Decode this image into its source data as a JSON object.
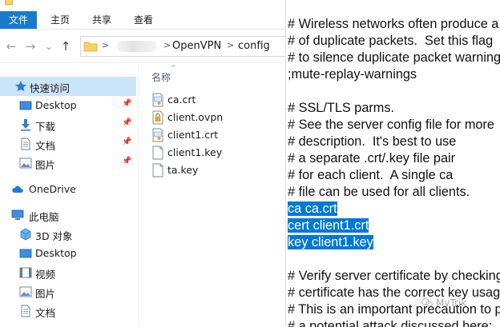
{
  "ribbon": {
    "tabs": [
      {
        "label": "文件",
        "active": true
      },
      {
        "label": "主页",
        "active": false
      },
      {
        "label": "共享",
        "active": false
      },
      {
        "label": "查看",
        "active": false
      }
    ]
  },
  "address_bar": {
    "nav_buttons": {
      "back": "←",
      "forward": "→",
      "recent": "⌄",
      "up": "↑"
    },
    "crumbs": [
      "OpenVPN",
      "config"
    ]
  },
  "nav_pane": {
    "items": [
      {
        "label": "快速访问",
        "icon": "star-icon",
        "selected": true,
        "pinned": false
      },
      {
        "label": "Desktop",
        "icon": "desktop-icon",
        "selected": false,
        "pinned": true
      },
      {
        "label": "下载",
        "icon": "download-icon",
        "selected": false,
        "pinned": true
      },
      {
        "label": "文档",
        "icon": "document-icon",
        "selected": false,
        "pinned": true
      },
      {
        "label": "图片",
        "icon": "picture-icon",
        "selected": false,
        "pinned": true
      },
      {
        "label": "OneDrive",
        "icon": "cloud-icon",
        "selected": false,
        "pinned": false
      },
      {
        "label": "此电脑",
        "icon": "computer-icon",
        "selected": false,
        "pinned": false
      },
      {
        "label": "3D 对象",
        "icon": "cube-icon",
        "selected": false,
        "pinned": false
      },
      {
        "label": "Desktop",
        "icon": "desktop-icon",
        "selected": false,
        "pinned": false
      },
      {
        "label": "视频",
        "icon": "video-icon",
        "selected": false,
        "pinned": false
      },
      {
        "label": "图片",
        "icon": "picture-icon",
        "selected": false,
        "pinned": false
      },
      {
        "label": "文档",
        "icon": "document-icon",
        "selected": false,
        "pinned": false
      }
    ]
  },
  "file_list": {
    "column_header": "名称",
    "sort_indicator": "^",
    "files": [
      {
        "name": "ca.crt",
        "icon": "certificate-icon"
      },
      {
        "name": "client.ovpn",
        "icon": "lock-file-icon"
      },
      {
        "name": "client1.crt",
        "icon": "certificate-icon"
      },
      {
        "name": "client1.key",
        "icon": "file-icon"
      },
      {
        "name": "ta.key",
        "icon": "file-icon"
      }
    ]
  },
  "notepad": {
    "lines": [
      {
        "text": "# Wireless networks often produce a lot",
        "selected": false
      },
      {
        "text": "# of duplicate packets.  Set this flag",
        "selected": false
      },
      {
        "text": "# to silence duplicate packet warnings.",
        "selected": false
      },
      {
        "text": ";mute-replay-warnings",
        "selected": false
      },
      {
        "text": "",
        "selected": false
      },
      {
        "text": "# SSL/TLS parms.",
        "selected": false
      },
      {
        "text": "# See the server config file for more",
        "selected": false
      },
      {
        "text": "# description.  It's best to use",
        "selected": false
      },
      {
        "text": "# a separate .crt/.key file pair",
        "selected": false
      },
      {
        "text": "# for each client.  A single ca",
        "selected": false
      },
      {
        "text": "# file can be used for all clients.",
        "selected": false
      },
      {
        "text": "ca ca.crt",
        "selected": true
      },
      {
        "text": "cert client1.crt",
        "selected": true
      },
      {
        "text": "key client1.key",
        "selected": true
      },
      {
        "text": "",
        "selected": false
      },
      {
        "text": "# Verify server certificate by checking that the",
        "selected": false
      },
      {
        "text": "# certificate has the correct key usage set.",
        "selected": false
      },
      {
        "text": "# This is an important precaution to protect against",
        "selected": false
      },
      {
        "text": "# a potential attack discussed here:",
        "selected": false
      }
    ]
  },
  "watermark": {
    "text": "MyTrik"
  },
  "colors": {
    "ribbon_active": "#1979ca",
    "nav_selected": "#cce4f7",
    "text_selection": "#0078d7"
  }
}
